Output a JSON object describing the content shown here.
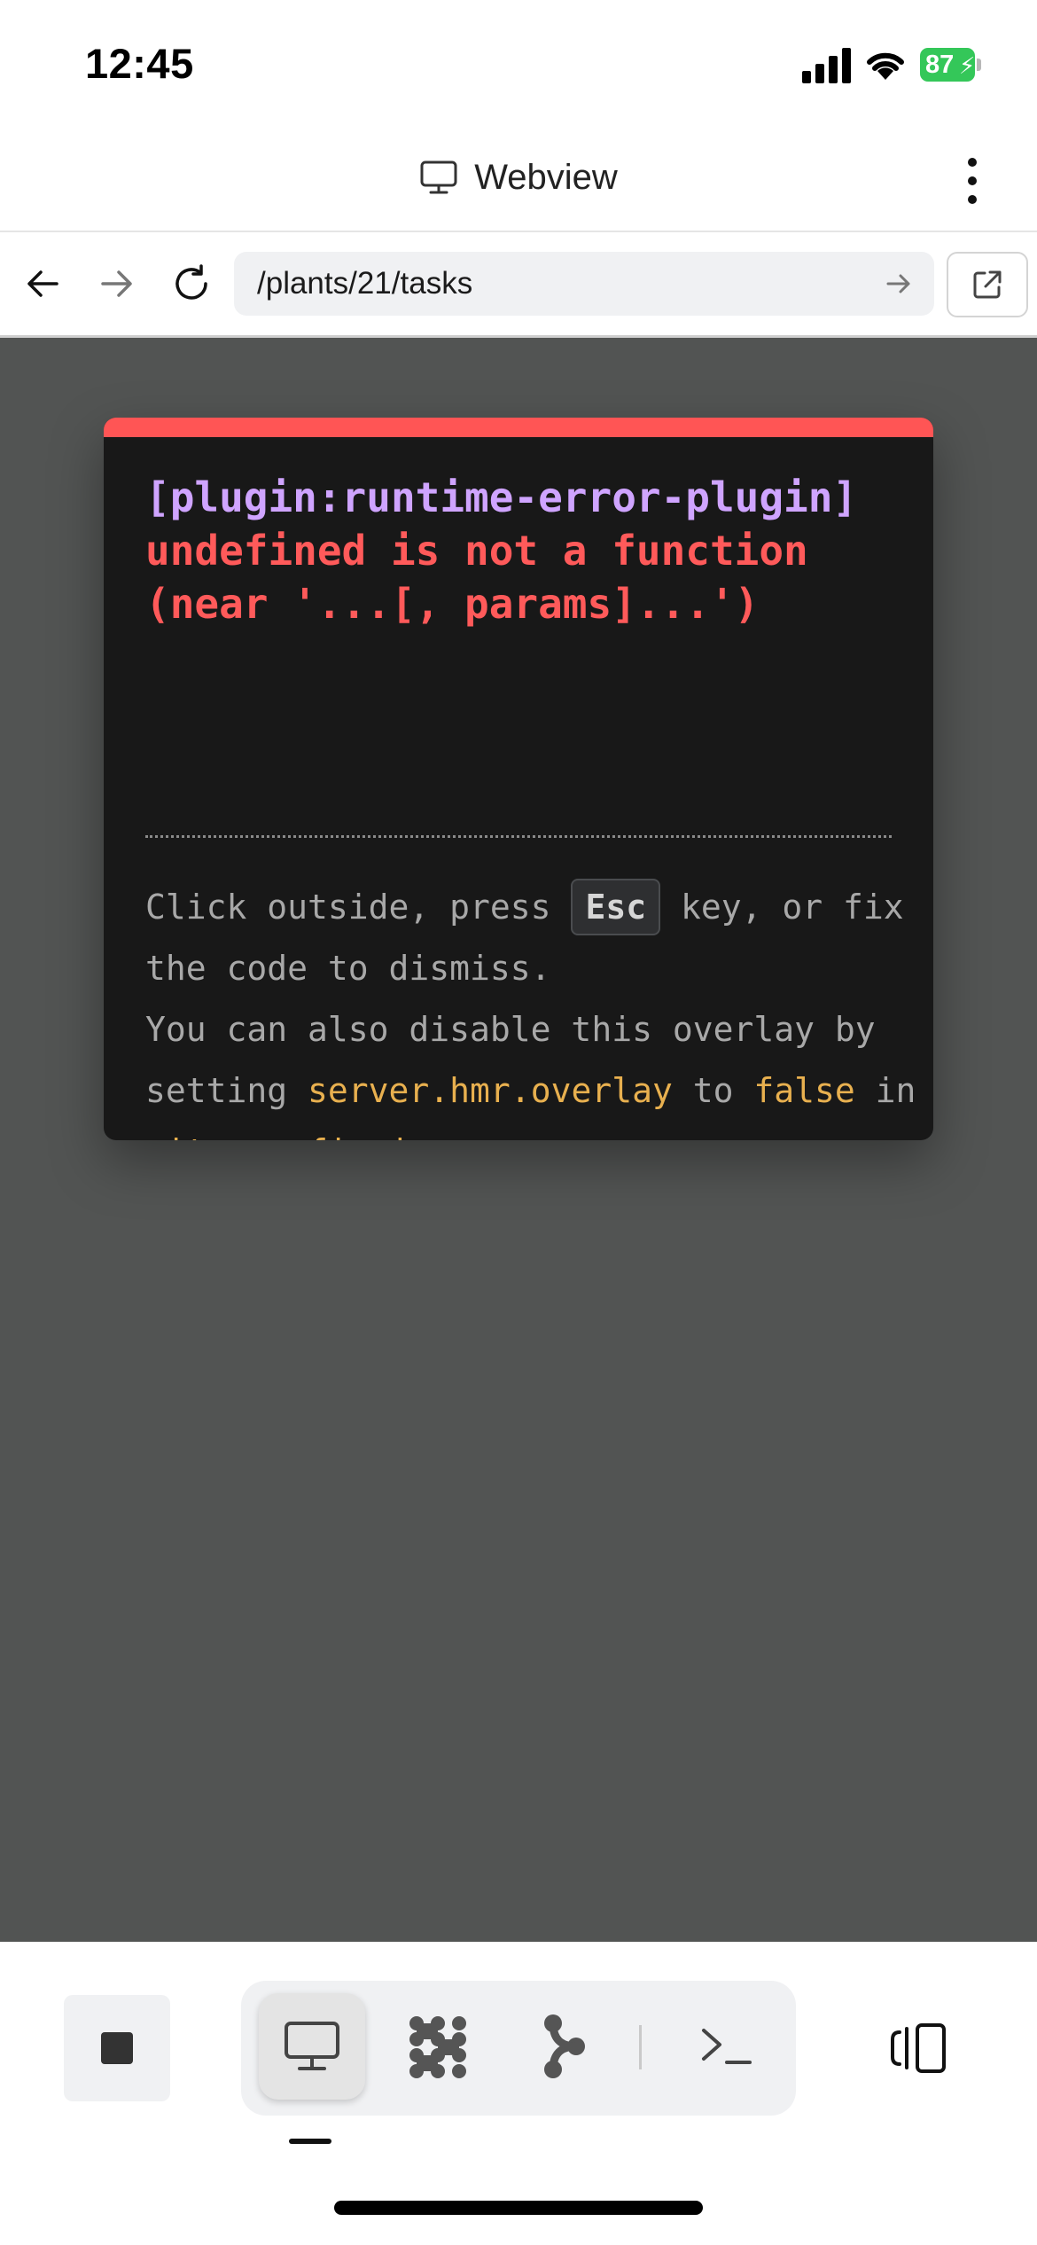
{
  "status_bar": {
    "time": "12:45",
    "battery": "87",
    "battery_color": "#34c759"
  },
  "header": {
    "icon": "monitor-icon",
    "title": "Webview"
  },
  "navbar": {
    "url": "/plants/21/tasks"
  },
  "overlay": {
    "accent_color": "#ff5555",
    "plugin": "[plugin:runtime-error-plugin]",
    "message": "undefined is not a function\n(near '...[, params]...')",
    "tip": {
      "p1": "Click outside, press ",
      "key": "Esc",
      "p2": " key, or fix the code to dismiss.",
      "p3": "You can also disable this overlay by setting ",
      "code1": "server.hmr.overlay",
      "p4": " to ",
      "code2": "false",
      "p5": " in ",
      "code3": "vite.config.js",
      "p6": "."
    }
  },
  "bottom_bar": {
    "tools": [
      "monitor-icon",
      "grid-dots-icon",
      "branch-icon",
      "terminal-icon"
    ],
    "active_tool": "monitor-icon"
  }
}
